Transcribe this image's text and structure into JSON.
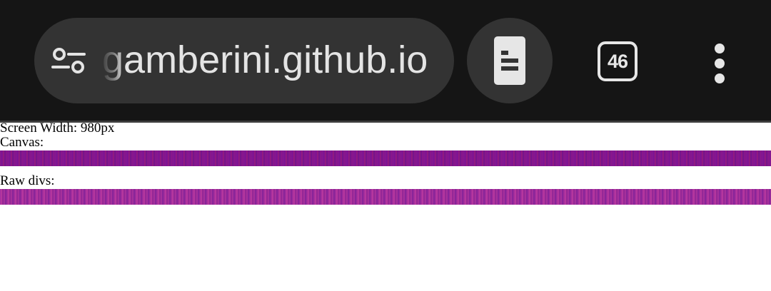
{
  "toolbar": {
    "url": "gamberini.github.io",
    "tab_count": "46",
    "icons": {
      "site_settings": "site-settings-icon",
      "reader_mode": "reader-mode-icon",
      "tab_switcher": "tab-switcher-icon",
      "menu": "more-vert-icon"
    },
    "colors": {
      "background": "#151515",
      "pill": "#333333",
      "text": "#e4e4e4"
    }
  },
  "page": {
    "screen_width_text": "Screen Width: 980px",
    "canvas_label": "Canvas:",
    "raw_divs_label": "Raw divs:",
    "colors": {
      "canvas_bar": "#7e1494",
      "divs_bar": "#a63098"
    }
  }
}
